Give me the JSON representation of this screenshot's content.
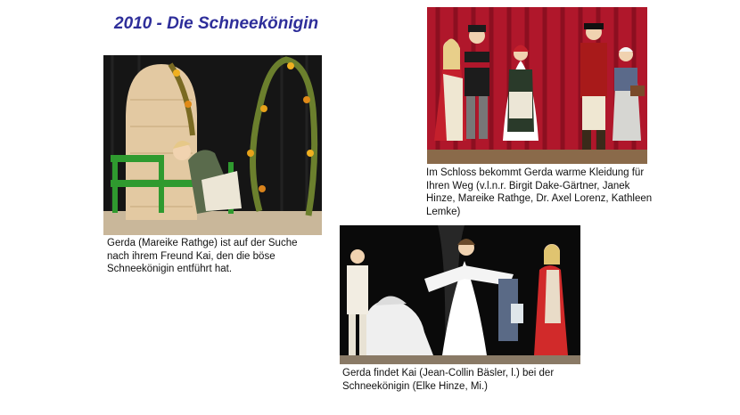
{
  "slide": {
    "title": "2010 - Die Schneekönigin",
    "photos": [
      {
        "id": "garden",
        "caption": "Gerda (Mareike Rathge) ist auf der Suche nach ihrem Freund Kai, den die böse Schneekönigin entführt hat."
      },
      {
        "id": "castle",
        "caption": "Im Schloss bekommt Gerda warme Kleidung für Ihren Weg (v.l.n.r. Birgit Dake-Gärtner, Janek Hinze, Mareike Rathge, Dr. Axel Lorenz, Kathleen Lemke)"
      },
      {
        "id": "snowqueen",
        "caption": "Gerda findet Kai (Jean-Collin Bäsler, l.) bei der Schneekönigin (Elke Hinze, Mi.)"
      }
    ]
  },
  "colors": {
    "title": "#2e2e9a",
    "curtain_red": "#b0172b",
    "stage_black": "#0a0a0a",
    "bench_green": "#2f9a2f"
  }
}
